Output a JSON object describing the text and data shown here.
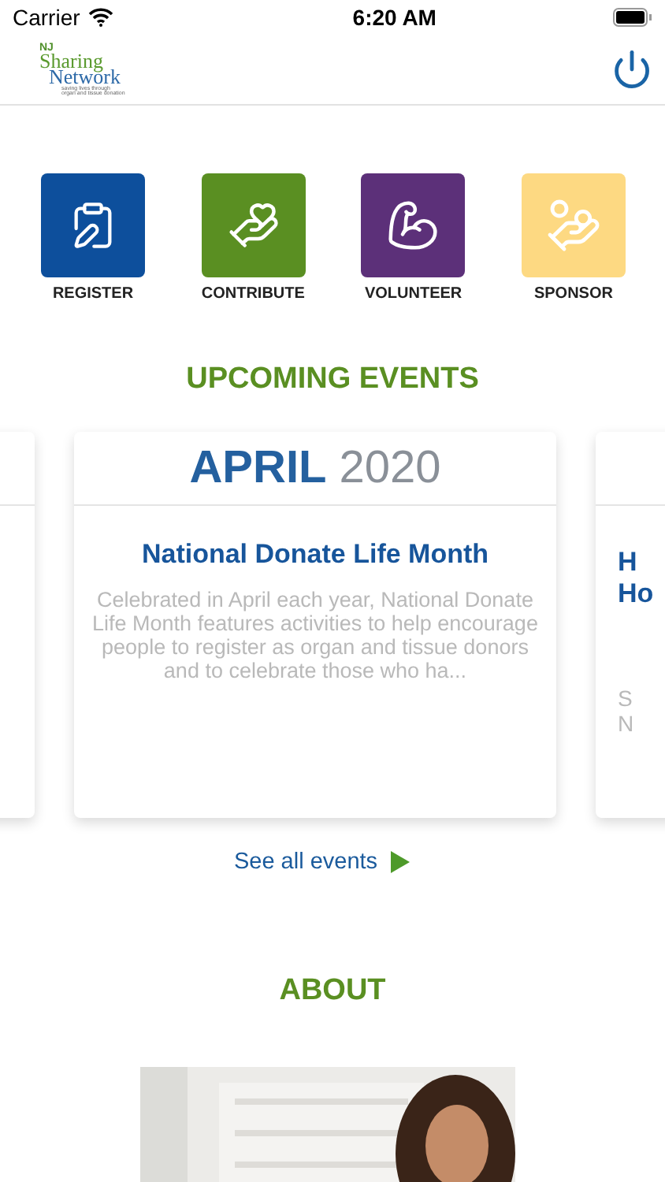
{
  "status_bar": {
    "carrier": "Carrier",
    "time": "6:20 AM"
  },
  "header": {
    "logo": {
      "prefix": "NJ",
      "line_1": "Sharing",
      "line_2": "Network",
      "tagline_1": "saving lives through",
      "tagline_2": "organ and tissue donation"
    }
  },
  "actions": [
    {
      "label": "REGISTER",
      "kind": "register",
      "color": "#0d4f9c"
    },
    {
      "label": "CONTRIBUTE",
      "kind": "contribute",
      "color": "#5a8f22"
    },
    {
      "label": "VOLUNTEER",
      "kind": "volunteer",
      "color": "#5c3079"
    },
    {
      "label": "SPONSOR",
      "kind": "sponsor",
      "color": "#fdd982"
    }
  ],
  "upcoming_events": {
    "title": "UPCOMING EVENTS",
    "cards": [
      {
        "kind": "partial"
      },
      {
        "kind": "full",
        "month": "APRIL",
        "year": "2020",
        "title": "National Donate Life Month",
        "description": "Celebrated in April each year, National Donate Life Month features activities to help encourage people to register as organ and tissue donors and to celebrate those who ha..."
      },
      {
        "kind": "partial",
        "title_lines": [
          "H",
          "Ho"
        ],
        "description_lines": [
          "S",
          "N"
        ]
      }
    ],
    "link": "See all events"
  },
  "about": {
    "title": "ABOUT"
  }
}
